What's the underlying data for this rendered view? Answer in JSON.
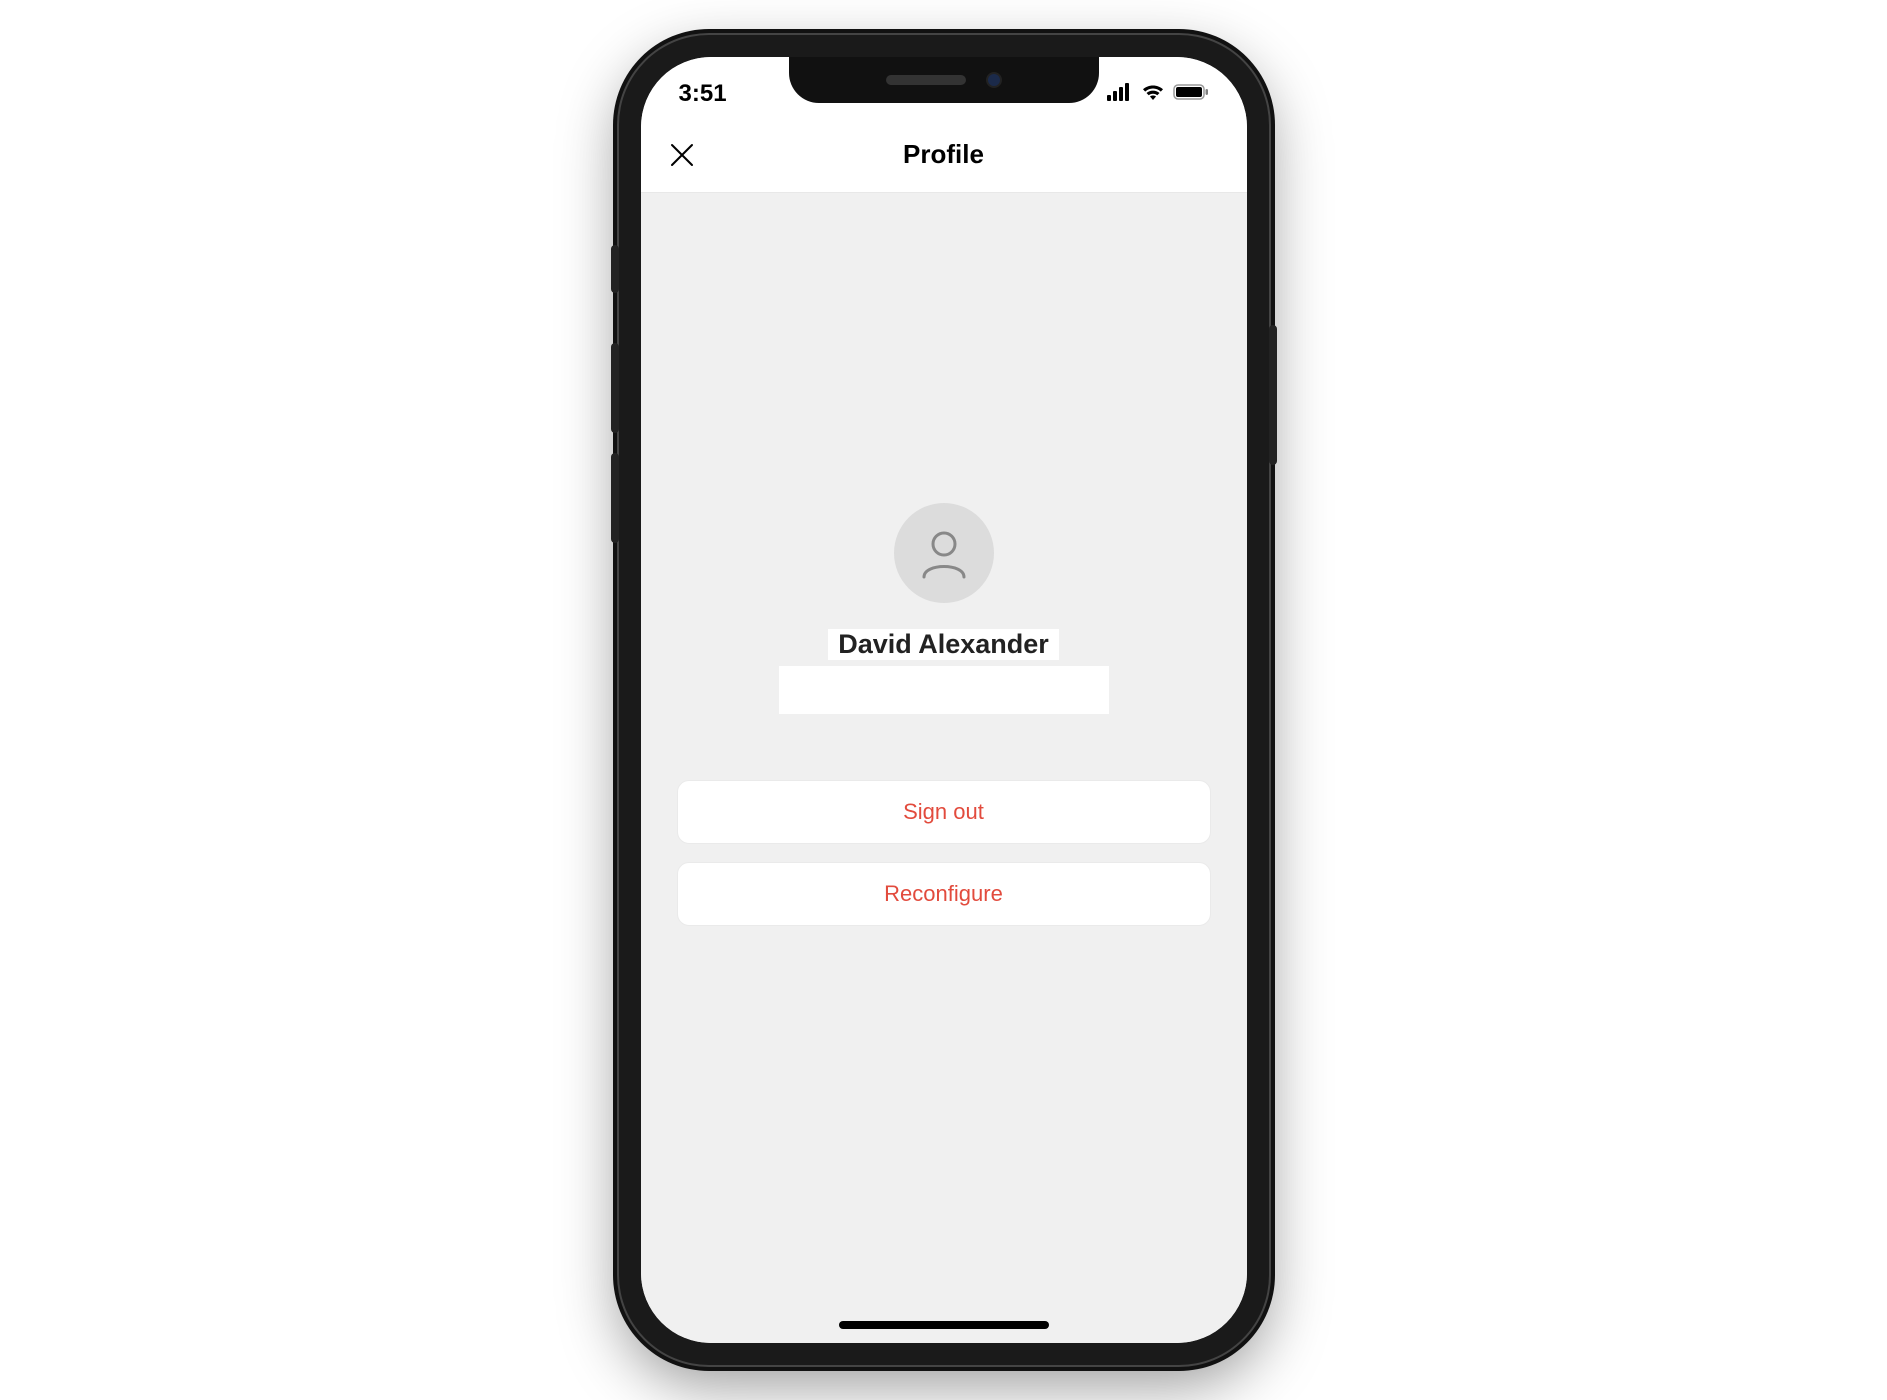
{
  "status": {
    "time": "3:51"
  },
  "header": {
    "title": "Profile"
  },
  "profile": {
    "name": "David Alexander"
  },
  "actions": {
    "sign_out": "Sign out",
    "reconfigure": "Reconfigure"
  },
  "colors": {
    "destructive": "#e24b3d",
    "screen_bg": "#f0f0f0"
  }
}
